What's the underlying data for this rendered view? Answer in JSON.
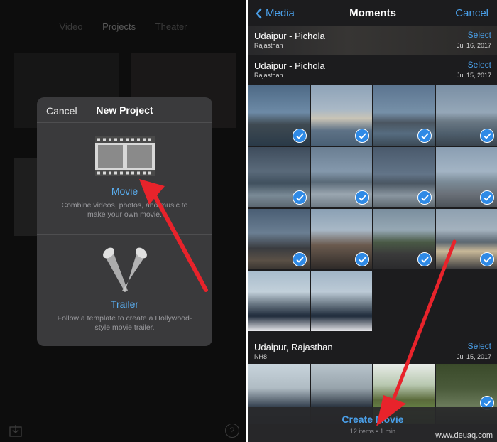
{
  "left": {
    "tabs": [
      "Video",
      "Projects",
      "Theater"
    ],
    "dialog": {
      "cancel_label": "Cancel",
      "title": "New Project",
      "movie": {
        "title": "Movie",
        "description": "Combine videos, photos, and music to make your own movie."
      },
      "trailer": {
        "title": "Trailer",
        "description": "Follow a template to create a Hollywood-style movie trailer."
      }
    },
    "help_label": "?"
  },
  "right": {
    "nav": {
      "back_label": "Media",
      "title": "Moments",
      "cancel_label": "Cancel"
    },
    "moments": [
      {
        "title": "Udaipur - Pichola",
        "subtitle": "Rajasthan",
        "select_label": "Select",
        "date": "Jul 16, 2017"
      },
      {
        "title": "Udaipur - Pichola",
        "subtitle": "Rajasthan",
        "select_label": "Select",
        "date": "Jul 15, 2017"
      },
      {
        "title": "Udaipur, Rajasthan",
        "subtitle": "NH8",
        "select_label": "Select",
        "date": "Jul 15, 2017"
      }
    ],
    "photos_selected": 12,
    "create_button_label": "Create Movie",
    "selection_info": "12 items • 1 min"
  },
  "watermark": "www.deuaq.com",
  "colors": {
    "accent": "#4a9fe8",
    "checkmark": "#2f8ae6",
    "arrow": "#e8232b"
  }
}
